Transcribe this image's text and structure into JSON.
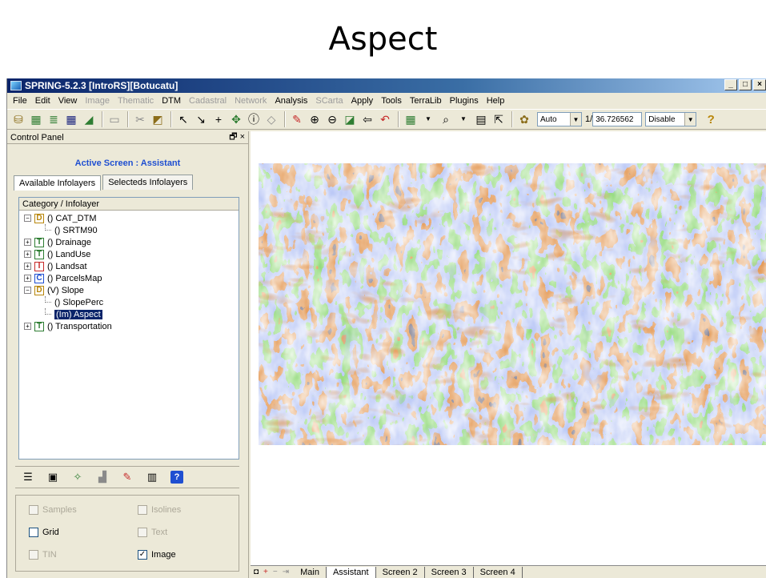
{
  "slide": {
    "title": "Aspect"
  },
  "window": {
    "title": "SPRING-5.2.3 [IntroRS][Botucatu]",
    "controls": {
      "minimize": "_",
      "maximize": "□",
      "close": "×"
    }
  },
  "menu": [
    {
      "label": "File",
      "enabled": true
    },
    {
      "label": "Edit",
      "enabled": true
    },
    {
      "label": "View",
      "enabled": true
    },
    {
      "label": "Image",
      "enabled": false
    },
    {
      "label": "Thematic",
      "enabled": false
    },
    {
      "label": "DTM",
      "enabled": true
    },
    {
      "label": "Cadastral",
      "enabled": false
    },
    {
      "label": "Network",
      "enabled": false
    },
    {
      "label": "Analysis",
      "enabled": true
    },
    {
      "label": "SCarta",
      "enabled": false
    },
    {
      "label": "Apply",
      "enabled": true
    },
    {
      "label": "Tools",
      "enabled": true
    },
    {
      "label": "TerraLib",
      "enabled": true
    },
    {
      "label": "Plugins",
      "enabled": true
    },
    {
      "label": "Help",
      "enabled": true
    }
  ],
  "toolbar": {
    "zoom_mode": "Auto",
    "scale_prefix": "1/",
    "scale_value": "36.726562",
    "mode": "Disable",
    "help_glyph": "?"
  },
  "control_panel": {
    "title": "Control Panel",
    "active_screen": "Active Screen : Assistant",
    "tabs": [
      "Available Infolayers",
      "Selecteds Infolayers"
    ],
    "tree_header": "Category / Infolayer",
    "tree": [
      {
        "level": 0,
        "expander": "−",
        "icon": "D",
        "icon_color": "#b8860b",
        "label": "() CAT_DTM"
      },
      {
        "level": 1,
        "label": "() SRTM90"
      },
      {
        "level": 0,
        "expander": "+",
        "icon": "T",
        "icon_color": "#2e7d32",
        "label": "() Drainage"
      },
      {
        "level": 0,
        "expander": "+",
        "icon": "T",
        "icon_color": "#2e7d32",
        "label": "() LandUse"
      },
      {
        "level": 0,
        "expander": "+",
        "icon": "I",
        "icon_color": "#c62828",
        "label": "() Landsat"
      },
      {
        "level": 0,
        "expander": "+",
        "icon": "C",
        "icon_color": "#1f4fd1",
        "label": "() ParcelsMap"
      },
      {
        "level": 0,
        "expander": "−",
        "icon": "D",
        "icon_color": "#b8860b",
        "label": "(V) Slope"
      },
      {
        "level": 1,
        "label": "() SlopePerc"
      },
      {
        "level": 1,
        "label": "(Im) Aspect",
        "selected": true
      },
      {
        "level": 0,
        "expander": "+",
        "icon": "T",
        "icon_color": "#2e7d32",
        "label": "() Transportation"
      }
    ],
    "options": [
      {
        "label": "Samples",
        "checked": false,
        "enabled": false
      },
      {
        "label": "Isolines",
        "checked": false,
        "enabled": false
      },
      {
        "label": "Grid",
        "checked": false,
        "enabled": true
      },
      {
        "label": "Text",
        "checked": false,
        "enabled": false
      },
      {
        "label": "TIN",
        "checked": false,
        "enabled": false
      },
      {
        "label": "Image",
        "checked": true,
        "enabled": true
      }
    ]
  },
  "screens": {
    "tabs": [
      "Main",
      "Assistant",
      "Screen 2",
      "Screen 3",
      "Screen 4"
    ],
    "active": "Assistant"
  },
  "colors": {
    "aspect_orange": "#c24a12",
    "aspect_green": "#3fae2a",
    "aspect_blue": "#6f86e8",
    "aspect_dark": "#2b2a38",
    "selection": "#0a246a",
    "active_screen_text": "#1f4fd1"
  }
}
